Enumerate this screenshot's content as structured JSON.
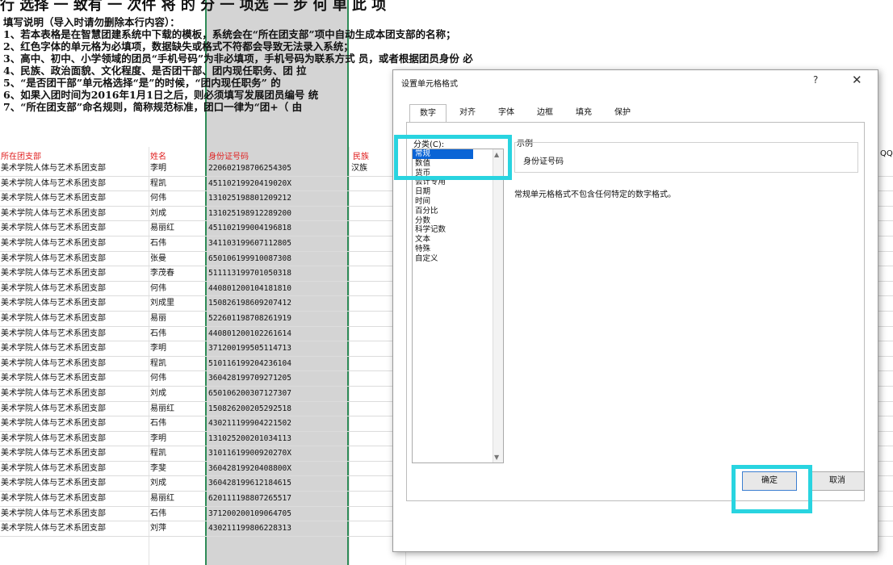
{
  "sheet": {
    "top_clipped_text": "行 选择 一 致有 一 次件 将 的 分 一 项选 一 步 何 单 此 项",
    "instructions": [
      "填写说明（导入时请勿删除本行内容）：",
      "1、若本表格是在智慧团建系统中下载的模板，系统会在“所在团支部”项中自动生成本团支部的名称；",
      "2、红色字体的单元格为必填项，数据缺失或格式不符都会导致无法录入系统；",
      "3、高中、初中、小学领域的团员“手机号码”为非必填项，手机号码为联系方式 员，或者根据团员身份 必",
      "4、民族、政治面貌、文化程度、是否团干部、团内现任职务、团 拉",
      "5、“是否团干部”单元格选择“是”的时候，“团内现任职务” 的",
      "6、如果入团时间为2016年1月1日之后，则必须填写发展团员编号 统",
      "7、“所在团支部”命名规则，简称规范标准，团口一律为“团+（ 由"
    ],
    "headers": {
      "branch": "所在团支部",
      "name": "姓名",
      "id": "身份证号码",
      "ethnicity": "民族",
      "qq": "QQ"
    },
    "rows": [
      {
        "branch": "美术学院人体与艺术系团支部",
        "name": "李明",
        "id": "220602198706254305",
        "eth": "汉族"
      },
      {
        "branch": "美术学院人体与艺术系团支部",
        "name": "程凯",
        "id": "45110219920419020X",
        "eth": ""
      },
      {
        "branch": "美术学院人体与艺术系团支部",
        "name": "何伟",
        "id": "131025198801209212",
        "eth": ""
      },
      {
        "branch": "美术学院人体与艺术系团支部",
        "name": "刘成",
        "id": "131025198912289200",
        "eth": ""
      },
      {
        "branch": "美术学院人体与艺术系团支部",
        "name": "易丽红",
        "id": "451102199004196818",
        "eth": ""
      },
      {
        "branch": "美术学院人体与艺术系团支部",
        "name": "石伟",
        "id": "341103199607112805",
        "eth": ""
      },
      {
        "branch": "美术学院人体与艺术系团支部",
        "name": "张曼",
        "id": "650106199910087308",
        "eth": ""
      },
      {
        "branch": "美术学院人体与艺术系团支部",
        "name": "李茂春",
        "id": "511113199701050318",
        "eth": ""
      },
      {
        "branch": "美术学院人体与艺术系团支部",
        "name": "何伟",
        "id": "440801200104181810",
        "eth": ""
      },
      {
        "branch": "美术学院人体与艺术系团支部",
        "name": "刘成里",
        "id": "150826198609207412",
        "eth": ""
      },
      {
        "branch": "美术学院人体与艺术系团支部",
        "name": "易丽",
        "id": "522601198708261919",
        "eth": ""
      },
      {
        "branch": "美术学院人体与艺术系团支部",
        "name": "石伟",
        "id": "440801200102261614",
        "eth": ""
      },
      {
        "branch": "美术学院人体与艺术系团支部",
        "name": "李明",
        "id": "371200199505114713",
        "eth": ""
      },
      {
        "branch": "美术学院人体与艺术系团支部",
        "name": "程凯",
        "id": "510116199204236104",
        "eth": ""
      },
      {
        "branch": "美术学院人体与艺术系团支部",
        "name": "何伟",
        "id": "360428199709271205",
        "eth": ""
      },
      {
        "branch": "美术学院人体与艺术系团支部",
        "name": "刘成",
        "id": "650106200307127307",
        "eth": ""
      },
      {
        "branch": "美术学院人体与艺术系团支部",
        "name": "易丽红",
        "id": "150826200205292518",
        "eth": ""
      },
      {
        "branch": "美术学院人体与艺术系团支部",
        "name": "石伟",
        "id": "430211199904221502",
        "eth": ""
      },
      {
        "branch": "美术学院人体与艺术系团支部",
        "name": "李明",
        "id": "131025200201034113",
        "eth": ""
      },
      {
        "branch": "美术学院人体与艺术系团支部",
        "name": "程凯",
        "id": "31011619900920270X",
        "eth": ""
      },
      {
        "branch": "美术学院人体与艺术系团支部",
        "name": "李斐",
        "id": "36042819920408800X",
        "eth": ""
      },
      {
        "branch": "美术学院人体与艺术系团支部",
        "name": "刘成",
        "id": "360428199612184615",
        "eth": ""
      },
      {
        "branch": "美术学院人体与艺术系团支部",
        "name": "易丽红",
        "id": "620111198807265517",
        "eth": ""
      },
      {
        "branch": "美术学院人体与艺术系团支部",
        "name": "石伟",
        "id": "371200200109064705",
        "eth": ""
      },
      {
        "branch": "美术学院人体与艺术系团支部",
        "name": "刘萍",
        "id": "430211199806228313",
        "eth": ""
      }
    ]
  },
  "dialog": {
    "title": "设置单元格格式",
    "help": "?",
    "close": "✕",
    "tabs": [
      "数字",
      "对齐",
      "字体",
      "边框",
      "填充",
      "保护"
    ],
    "category_label": "分类(C):",
    "categories": [
      "常规",
      "数值",
      "货币",
      "会计专用",
      "日期",
      "时间",
      "百分比",
      "分数",
      "科学记数",
      "文本",
      "特殊",
      "自定义"
    ],
    "selected_category": "常规",
    "sample_label": "示例",
    "sample_value": "身份证号码",
    "description": "常规单元格格式不包含任何特定的数字格式。",
    "ok": "确定",
    "cancel": "取消"
  },
  "colors": {
    "highlight": "#29d4e0",
    "selection": "#0a64d6",
    "required_header": "#e02020",
    "column_border": "#2e8b57"
  }
}
